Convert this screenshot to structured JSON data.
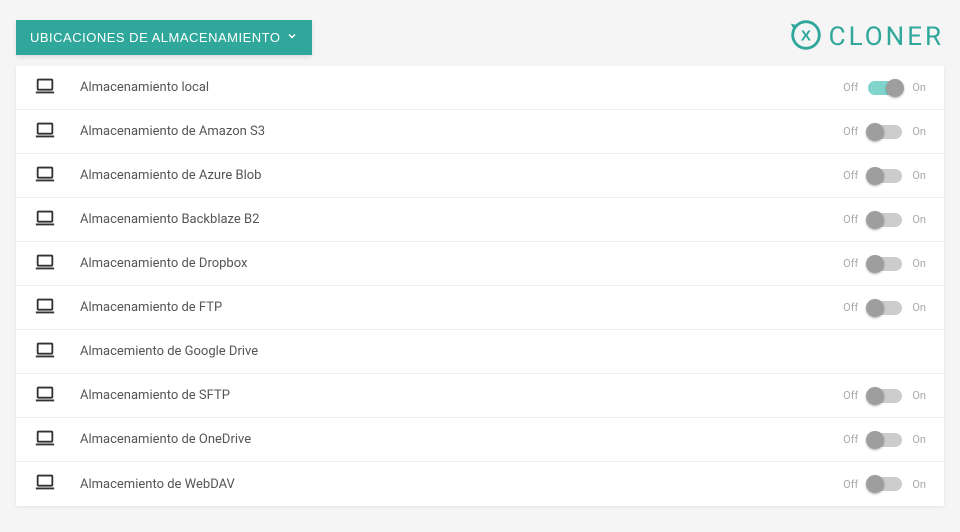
{
  "header": {
    "dropdown_label": "UBICACIONES DE ALMACENAMIENTO",
    "logo_text": "CLONER"
  },
  "toggle": {
    "off_label": "Off",
    "on_label": "On"
  },
  "storage": [
    {
      "label": "Almacenamiento local",
      "enabled": true
    },
    {
      "label": "Almacenamiento de Amazon S3",
      "enabled": false
    },
    {
      "label": "Almacenamiento de Azure Blob",
      "enabled": false
    },
    {
      "label": " Almacenamiento Backblaze B2",
      "enabled": false
    },
    {
      "label": "Almacenamiento de Dropbox",
      "enabled": false
    },
    {
      "label": "Almacenamiento de FTP",
      "enabled": false
    },
    {
      "label": "Almacemiento de Google Drive",
      "enabled": false,
      "no_toggle": true
    },
    {
      "label": "Almacenamiento de SFTP",
      "enabled": false
    },
    {
      "label": "Almacenamiento de OneDrive",
      "enabled": false
    },
    {
      "label": "Almacemiento de WebDAV",
      "enabled": false
    }
  ]
}
